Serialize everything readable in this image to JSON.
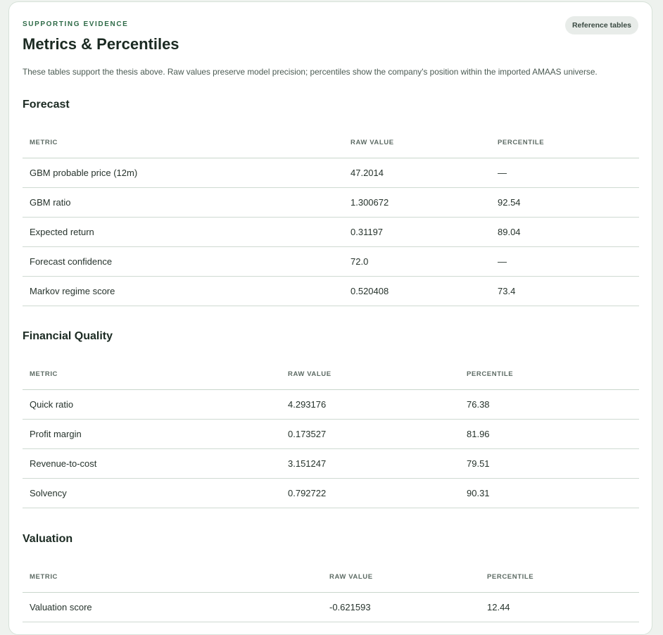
{
  "header": {
    "eyebrow": "SUPPORTING EVIDENCE",
    "title": "Metrics & Percentiles",
    "reference_button": "Reference tables",
    "intro": "These tables support the thesis above. Raw values preserve model precision; percentiles show the company's position within the imported AMAAS universe."
  },
  "columns": {
    "metric": "METRIC",
    "raw": "RAW VALUE",
    "percentile": "PERCENTILE"
  },
  "sections": [
    {
      "title": "Forecast",
      "rows": [
        {
          "metric": "GBM probable price (12m)",
          "raw": "47.2014",
          "percentile": "—"
        },
        {
          "metric": "GBM ratio",
          "raw": "1.300672",
          "percentile": "92.54"
        },
        {
          "metric": "Expected return",
          "raw": "0.31197",
          "percentile": "89.04"
        },
        {
          "metric": "Forecast confidence",
          "raw": "72.0",
          "percentile": "—"
        },
        {
          "metric": "Markov regime score",
          "raw": "0.520408",
          "percentile": "73.4"
        }
      ]
    },
    {
      "title": "Financial Quality",
      "rows": [
        {
          "metric": "Quick ratio",
          "raw": "4.293176",
          "percentile": "76.38"
        },
        {
          "metric": "Profit margin",
          "raw": "0.173527",
          "percentile": "81.96"
        },
        {
          "metric": "Revenue-to-cost",
          "raw": "3.151247",
          "percentile": "79.51"
        },
        {
          "metric": "Solvency",
          "raw": "0.792722",
          "percentile": "90.31"
        }
      ]
    },
    {
      "title": "Valuation",
      "rows": [
        {
          "metric": "Valuation score",
          "raw": "-0.621593",
          "percentile": "12.44"
        }
      ]
    }
  ]
}
